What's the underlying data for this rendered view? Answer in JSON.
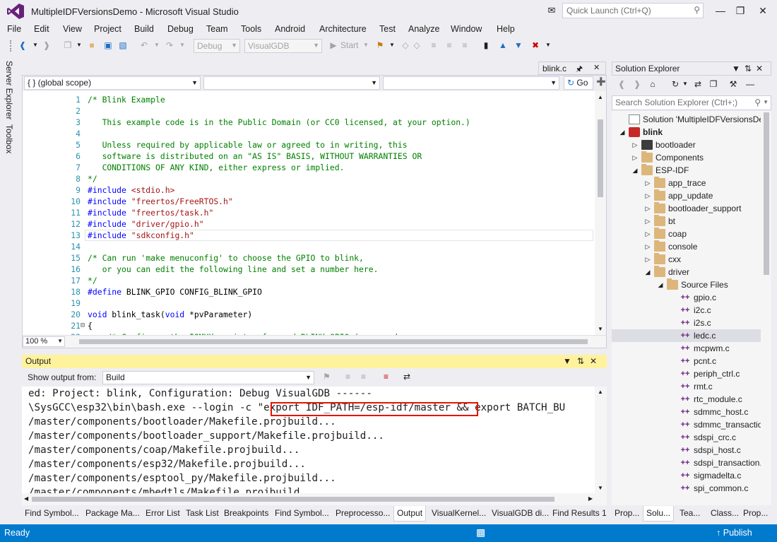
{
  "window": {
    "title": "MultipleIDFVersionsDemo - Microsoft Visual Studio",
    "quick_launch_placeholder": "Quick Launch (Ctrl+Q)"
  },
  "menu": [
    "File",
    "Edit",
    "View",
    "Project",
    "Build",
    "Debug",
    "Team",
    "Tools",
    "Android",
    "Architecture",
    "Test",
    "Analyze",
    "Window",
    "Help"
  ],
  "toolbar": {
    "config": "Debug",
    "platform": "VisualGDB",
    "start_label": "Start"
  },
  "left_rail": [
    "Server Explorer",
    "Toolbox"
  ],
  "editor": {
    "tab_label": "blink.c",
    "scope": "{ } (global scope)",
    "go_label": "Go",
    "zoom": "100 %",
    "lines": [
      {
        "n": "1",
        "t": "/* Blink Example",
        "k": "comment"
      },
      {
        "n": "2",
        "t": "",
        "k": "comment"
      },
      {
        "n": "3",
        "t": "   This example code is in the Public Domain (or CC0 licensed, at your option.)",
        "k": "comment"
      },
      {
        "n": "4",
        "t": "",
        "k": "comment"
      },
      {
        "n": "5",
        "t": "   Unless required by applicable law or agreed to in writing, this",
        "k": "comment"
      },
      {
        "n": "6",
        "t": "   software is distributed on an \"AS IS\" BASIS, WITHOUT WARRANTIES OR",
        "k": "comment"
      },
      {
        "n": "7",
        "t": "   CONDITIONS OF ANY KIND, either express or implied.",
        "k": "comment"
      },
      {
        "n": "8",
        "t": "*/",
        "k": "comment"
      },
      {
        "n": "9",
        "t": "#include <stdio.h>",
        "k": "pre",
        "inc": "<stdio.h>"
      },
      {
        "n": "10",
        "t": "#include \"freertos/FreeRTOS.h\"",
        "k": "pre",
        "inc": "\"freertos/FreeRTOS.h\""
      },
      {
        "n": "11",
        "t": "#include \"freertos/task.h\"",
        "k": "pre",
        "inc": "\"freertos/task.h\""
      },
      {
        "n": "12",
        "t": "#include \"driver/gpio.h\"",
        "k": "pre",
        "inc": "\"driver/gpio.h\""
      },
      {
        "n": "13",
        "t": "#include \"sdkconfig.h\"",
        "k": "pre",
        "inc": "\"sdkconfig.h\""
      },
      {
        "n": "14",
        "t": "",
        "k": "plain"
      },
      {
        "n": "15",
        "t": "/* Can run 'make menuconfig' to choose the GPIO to blink,",
        "k": "comment"
      },
      {
        "n": "16",
        "t": "   or you can edit the following line and set a number here.",
        "k": "comment"
      },
      {
        "n": "17",
        "t": "*/",
        "k": "comment"
      },
      {
        "n": "18",
        "t": "#define BLINK_GPIO CONFIG_BLINK_GPIO",
        "k": "define"
      },
      {
        "n": "19",
        "t": "",
        "k": "plain"
      },
      {
        "n": "20",
        "t": "void blink_task(void *pvParameter)",
        "k": "func"
      },
      {
        "n": "21",
        "t": "{",
        "k": "plain"
      },
      {
        "n": "22",
        "t": "    /* Configure the IOMUX register for pad BLINK_GPIO (some pads are",
        "k": "comment"
      }
    ]
  },
  "output": {
    "title": "Output",
    "show_from_label": "Show output from:",
    "source": "Build",
    "lines": [
      "ed: Project: blink, Configuration: Debug VisualGDB ------",
      "\\SysGCC\\esp32\\bin\\bash.exe --login -c \"export IDF_PATH=/esp-idf/master && export BATCH_BU",
      "/master/components/bootloader/Makefile.projbuild...",
      "/master/components/bootloader_support/Makefile.projbuild...",
      "/master/components/coap/Makefile.projbuild...",
      "/master/components/esp32/Makefile.projbuild...",
      "/master/components/esptool_py/Makefile.projbuild...",
      "/master/components/mbedtls/Makefile.projbuild..."
    ]
  },
  "bottom_tabs": [
    "Find Symbol...",
    "Package Ma...",
    "Error List",
    "Task List",
    "Breakpoints",
    "Find Symbol...",
    "Preprocesso...",
    "Output",
    "VisualKernel...",
    "VisualGDB di...",
    "Find Results 1"
  ],
  "solution_explorer": {
    "title": "Solution Explorer",
    "search_placeholder": "Search Solution Explorer (Ctrl+;)",
    "tree": [
      {
        "label": "Solution 'MultipleIDFVersionsDemo'",
        "level": 0,
        "icon": "solution",
        "tri": ""
      },
      {
        "label": "blink",
        "level": 0,
        "icon": "project",
        "tri": "open",
        "bold": true
      },
      {
        "label": "bootloader",
        "level": 1,
        "icon": "project-small",
        "tri": "closed"
      },
      {
        "label": "Components",
        "level": 1,
        "icon": "folder",
        "tri": "closed"
      },
      {
        "label": "ESP-IDF",
        "level": 1,
        "icon": "folder",
        "tri": "open"
      },
      {
        "label": "app_trace",
        "level": 2,
        "icon": "folder",
        "tri": "closed"
      },
      {
        "label": "app_update",
        "level": 2,
        "icon": "folder",
        "tri": "closed"
      },
      {
        "label": "bootloader_support",
        "level": 2,
        "icon": "folder",
        "tri": "closed"
      },
      {
        "label": "bt",
        "level": 2,
        "icon": "folder",
        "tri": "closed"
      },
      {
        "label": "coap",
        "level": 2,
        "icon": "folder",
        "tri": "closed"
      },
      {
        "label": "console",
        "level": 2,
        "icon": "folder",
        "tri": "closed"
      },
      {
        "label": "cxx",
        "level": 2,
        "icon": "folder",
        "tri": "closed"
      },
      {
        "label": "driver",
        "level": 2,
        "icon": "folder",
        "tri": "open"
      },
      {
        "label": "Source Files",
        "level": 3,
        "icon": "folder",
        "tri": "open"
      },
      {
        "label": "gpio.c",
        "level": 4,
        "icon": "cfile",
        "tri": ""
      },
      {
        "label": "i2c.c",
        "level": 4,
        "icon": "cfile",
        "tri": ""
      },
      {
        "label": "i2s.c",
        "level": 4,
        "icon": "cfile",
        "tri": ""
      },
      {
        "label": "ledc.c",
        "level": 4,
        "icon": "cfile",
        "tri": "",
        "selected": true
      },
      {
        "label": "mcpwm.c",
        "level": 4,
        "icon": "cfile",
        "tri": ""
      },
      {
        "label": "pcnt.c",
        "level": 4,
        "icon": "cfile",
        "tri": ""
      },
      {
        "label": "periph_ctrl.c",
        "level": 4,
        "icon": "cfile",
        "tri": ""
      },
      {
        "label": "rmt.c",
        "level": 4,
        "icon": "cfile",
        "tri": ""
      },
      {
        "label": "rtc_module.c",
        "level": 4,
        "icon": "cfile",
        "tri": ""
      },
      {
        "label": "sdmmc_host.c",
        "level": 4,
        "icon": "cfile",
        "tri": ""
      },
      {
        "label": "sdmmc_transaction.c",
        "level": 4,
        "icon": "cfile",
        "tri": ""
      },
      {
        "label": "sdspi_crc.c",
        "level": 4,
        "icon": "cfile",
        "tri": ""
      },
      {
        "label": "sdspi_host.c",
        "level": 4,
        "icon": "cfile",
        "tri": ""
      },
      {
        "label": "sdspi_transaction.c",
        "level": 4,
        "icon": "cfile",
        "tri": ""
      },
      {
        "label": "sigmadelta.c",
        "level": 4,
        "icon": "cfile",
        "tri": ""
      },
      {
        "label": "spi_common.c",
        "level": 4,
        "icon": "cfile",
        "tri": ""
      }
    ],
    "tabs": [
      "Prop...",
      "Solu...",
      "Tea...",
      "Class...",
      "Prop..."
    ]
  },
  "status": {
    "left": "Ready",
    "right": "Publish"
  },
  "colors": {
    "accent": "#007ACC",
    "output_header": "#FFF29D",
    "highlight_border": "#E51400",
    "vs_purple": "#68217A"
  }
}
